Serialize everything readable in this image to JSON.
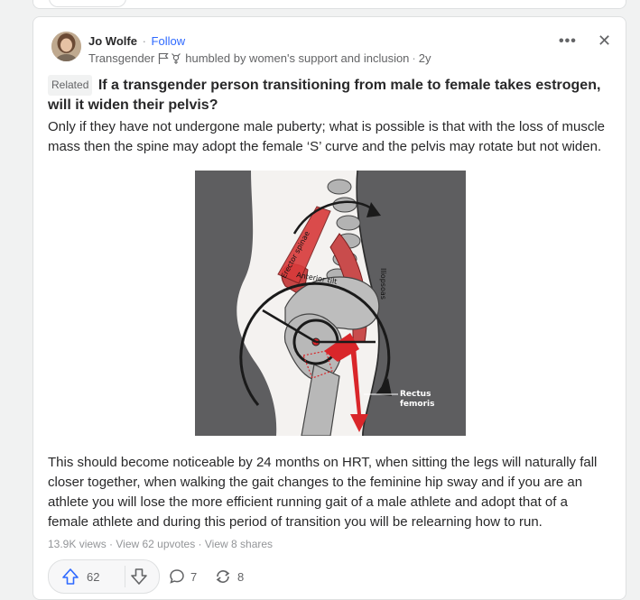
{
  "post": {
    "author": "Jo Wolfe",
    "separator": "·",
    "follow_label": "Follow",
    "credential_prefix": "Transgender",
    "credential_suffix": "humbled by women's support and inclusion",
    "time": "2y",
    "related_label": "Related",
    "question": "If a transgender person transitioning from male to female takes estrogen, will it widen their pelvis?",
    "paragraph1": "Only if they have not undergone male puberty; what is possible is that with the loss of muscle mass then the spine may adopt the female ‘S’ curve and the pelvis may rotate but not widen.",
    "paragraph2": "This should become noticeable by 24 months on HRT, when sitting the legs will naturally fall closer together, when walking the gait changes to the feminine hip sway and if you are an athlete you will lose the more efficient running gait of a male athlete and adopt that of a female athlete and during this period of transition you will be relearning how to run."
  },
  "figure": {
    "label_erector": "Erector spinae",
    "label_tilt": "Anterior tilt",
    "label_iliopsoas": "Iliopsoas",
    "label_rectus1": "Rectus",
    "label_rectus2": "femoris"
  },
  "stats": {
    "views": "13.9K views",
    "upvotes": "View 62 upvotes",
    "shares": "View 8 shares",
    "sep": " · "
  },
  "actions": {
    "upvote_count": "62",
    "comment_count": "7",
    "share_count": "8"
  },
  "icons": {
    "more": "more-icon",
    "close": "close-icon",
    "upvote": "upvote-icon",
    "downvote": "downvote-icon",
    "comment": "comment-icon",
    "share": "share-icon",
    "flag": "flag-icon",
    "transgender_symbol": "transgender-symbol-icon"
  },
  "colors": {
    "accent": "#2e69ff",
    "muscle_red": "#d6262a"
  }
}
